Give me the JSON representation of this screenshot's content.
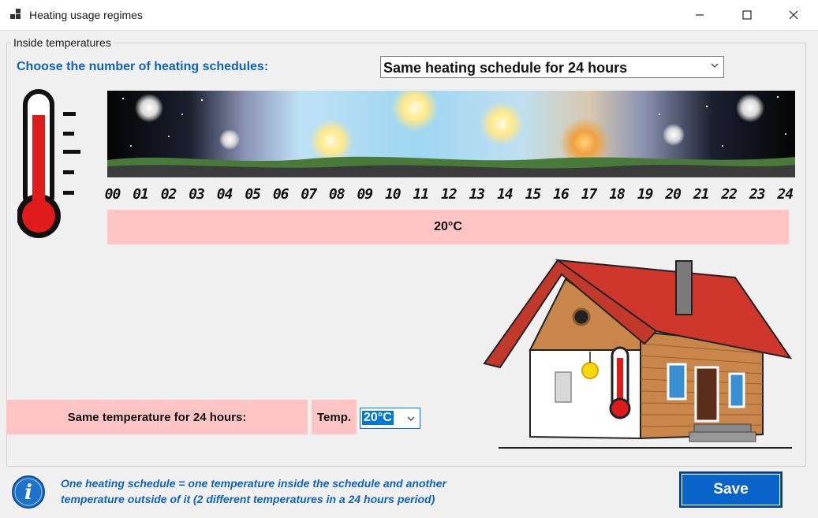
{
  "window": {
    "title": "Heating usage regimes",
    "minimize_icon": "minimize-icon",
    "maximize_icon": "maximize-icon",
    "close_icon": "close-icon"
  },
  "group": {
    "label": "Inside temperatures"
  },
  "schedule": {
    "label": "Choose the number of heating schedules:",
    "selected": "Same heating schedule for 24 hours"
  },
  "timeline": {
    "hours": [
      "00",
      "01",
      "02",
      "03",
      "04",
      "05",
      "06",
      "07",
      "08",
      "09",
      "10",
      "11",
      "12",
      "13",
      "14",
      "15",
      "16",
      "17",
      "18",
      "19",
      "20",
      "21",
      "22",
      "23",
      "24"
    ],
    "temperature": "20°C"
  },
  "same_temp": {
    "label": "Same temperature for 24 hours:",
    "temp_label": "Temp.",
    "temp_value": "20°C"
  },
  "info": {
    "icon": "info-icon",
    "text_line1": "One heating schedule = one temperature inside the schedule and another",
    "text_line2": "temperature outside of it (2 different temperatures in a 24 hours period)"
  },
  "actions": {
    "save_label": "Save"
  },
  "colors": {
    "accent_blue": "#1163b9",
    "save_button": "#0a63c9",
    "highlight_pink": "#ffc4c4",
    "thermometer_red": "#e01b1b"
  }
}
